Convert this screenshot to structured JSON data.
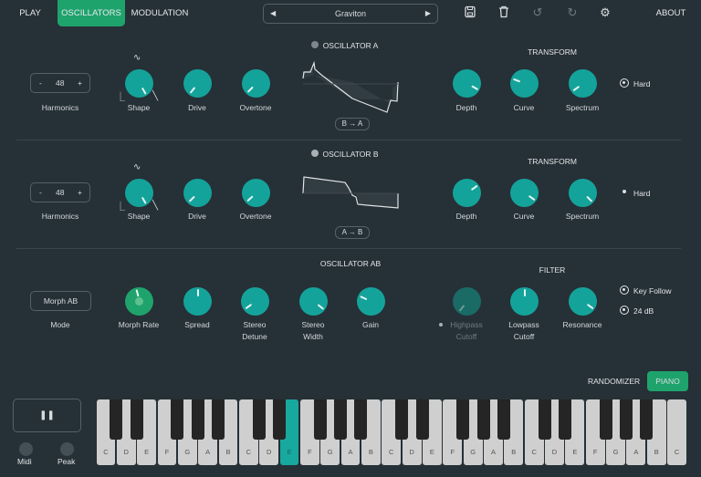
{
  "nav": {
    "play": "PLAY",
    "oscillators": "OSCILLATORS",
    "modulation": "MODULATION",
    "about": "ABOUT"
  },
  "preset": {
    "name": "Graviton",
    "prev": "◀",
    "next": "▶"
  },
  "toolbar": {
    "save": "save-icon",
    "delete": "trash-icon",
    "undo": "undo-icon",
    "redo": "redo-icon",
    "settings": "gear-icon"
  },
  "osc_a": {
    "title": "OSCILLATOR A",
    "harmonics_value": "48",
    "harmonics_minus": "-",
    "harmonics_plus": "+",
    "harmonics_label": "Harmonics",
    "swap": "B → A",
    "transform_title": "TRANSFORM",
    "hard": "Hard",
    "knobs": [
      {
        "label": "Shape",
        "value": 1.0
      },
      {
        "label": "Drive",
        "value": 0.03
      },
      {
        "label": "Overtone",
        "value": 0.05
      },
      {
        "label": "Depth",
        "value": 0.9
      },
      {
        "label": "Curve",
        "value": 0.27
      },
      {
        "label": "Spectrum",
        "value": 0.08
      }
    ]
  },
  "osc_b": {
    "title": "OSCILLATOR B",
    "harmonics_value": "48",
    "harmonics_minus": "-",
    "harmonics_plus": "+",
    "harmonics_label": "Harmonics",
    "swap": "A → B",
    "transform_title": "TRANSFORM",
    "hard": "Hard",
    "knobs": [
      {
        "label": "Shape",
        "value": 1.0
      },
      {
        "label": "Drive",
        "value": 0.05
      },
      {
        "label": "Overtone",
        "value": 0.06
      },
      {
        "label": "Depth",
        "value": 0.68
      },
      {
        "label": "Curve",
        "value": 0.92
      },
      {
        "label": "Spectrum",
        "value": 0.95
      }
    ]
  },
  "osc_ab": {
    "title": "OSCILLATOR AB",
    "mode_value": "Morph AB",
    "mode_label": "Mode",
    "filter_title": "FILTER",
    "key_follow": "Key Follow",
    "db": "24 dB",
    "knobs": [
      {
        "label": "Morph Rate",
        "value": 0.45
      },
      {
        "label": "Spread",
        "value": 0.5
      },
      {
        "label": "Stereo Detune",
        "value": 0.08
      },
      {
        "label": "Stereo Width",
        "value": 0.93
      },
      {
        "label": "Gain",
        "value": 0.28
      },
      {
        "label": "Highpass Cutoff",
        "value": 0.03
      },
      {
        "label": "Lowpass Cutoff",
        "value": 0.5
      },
      {
        "label": "Resonance",
        "value": 0.92
      }
    ]
  },
  "bottom": {
    "randomizer": "RANDOMIZER",
    "piano": "PIANO",
    "pause": "❚❚",
    "midi": "Midi",
    "peak": "Peak"
  },
  "piano": {
    "white_keys": [
      "C",
      "D",
      "E",
      "F",
      "G",
      "A",
      "B",
      "C",
      "D",
      "E",
      "F",
      "G",
      "A",
      "B",
      "C",
      "D",
      "E",
      "F",
      "G",
      "A",
      "B",
      "C",
      "D",
      "E",
      "F",
      "G",
      "A",
      "B",
      "C"
    ],
    "active_key_index": 9
  },
  "colors": {
    "accent": "#1fa36c",
    "knob": "#14a39a",
    "bg": "#263037"
  }
}
